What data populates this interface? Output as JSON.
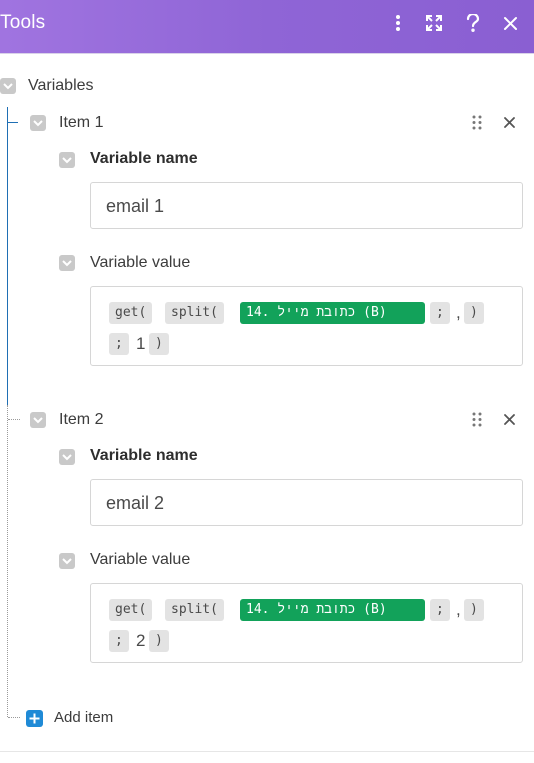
{
  "header": {
    "title": "Tools",
    "icons": [
      "kebab-menu-icon",
      "expand-icon",
      "help-icon",
      "close-icon"
    ],
    "bg": "#9a6edb"
  },
  "variables_label": "Variables",
  "items": [
    {
      "label": "Item 1",
      "name_label": "Variable name",
      "name_value": "email 1",
      "value_label": "Variable value",
      "tokens": {
        "get": "get(",
        "split": "split(",
        "field": "14. כתובת מייל (B)",
        "sep1": ";",
        "comma": ",",
        "close1": ")",
        "sep2": ";",
        "index": "1",
        "close2": ")"
      }
    },
    {
      "label": "Item 2",
      "name_label": "Variable name",
      "name_value": "email 2",
      "value_label": "Variable value",
      "tokens": {
        "get": "get(",
        "split": "split(",
        "field": "14. כתובת מייל (B)",
        "sep1": ";",
        "comma": ",",
        "close1": ")",
        "sep2": ";",
        "index": "2",
        "close2": ")"
      }
    }
  ],
  "add_item_label": "Add item",
  "colors": {
    "accent": "#1f8ad6",
    "field_pill": "#12a25a",
    "pill": "#e3e3e3"
  }
}
